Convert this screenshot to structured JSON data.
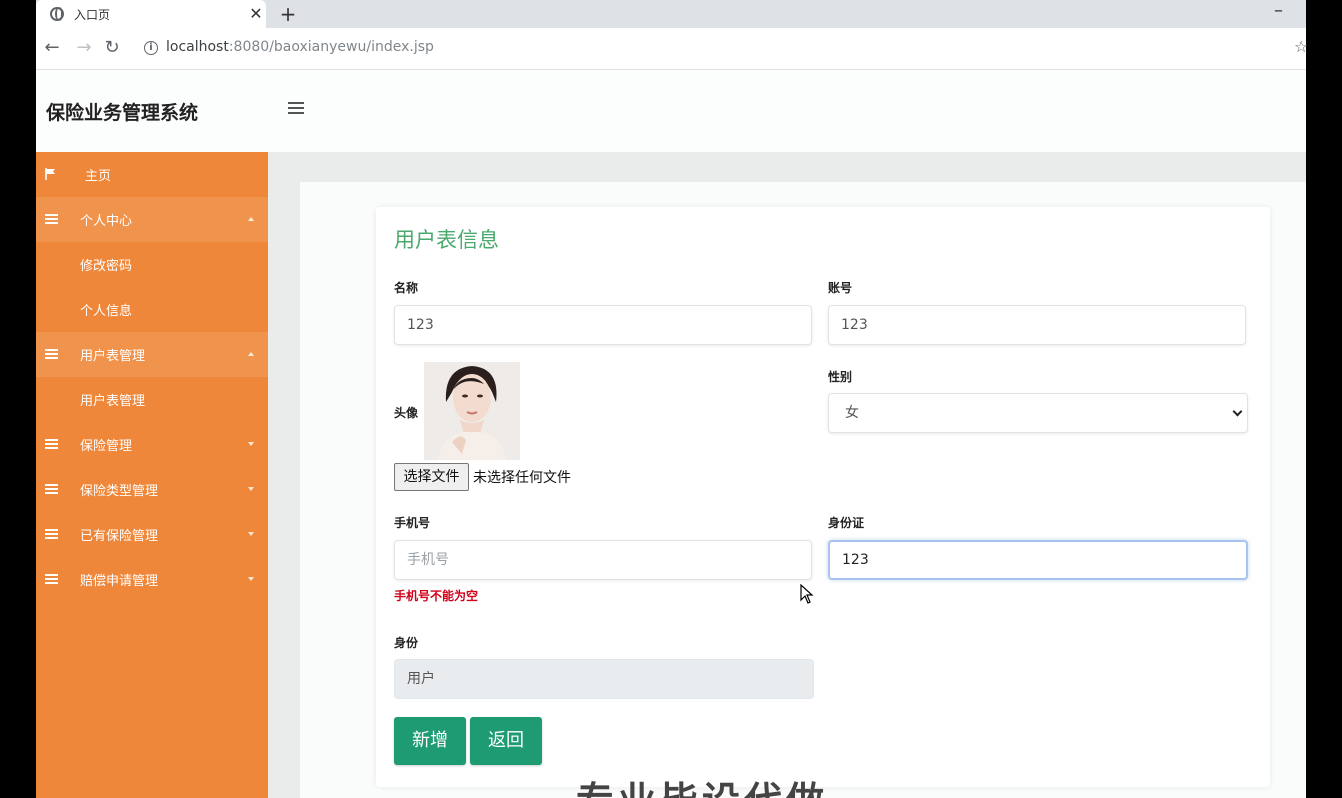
{
  "browser": {
    "tab_title": "入口页",
    "tab_close": "✕",
    "new_tab": "+",
    "minimize": "–",
    "back": "←",
    "forward": "→",
    "reload": "↻",
    "info": "i",
    "url_host": "localhost",
    "url_rest": ":8080/baoxianyewu/index.jsp",
    "bookmark": "☆"
  },
  "app": {
    "title": "保险业务管理系统"
  },
  "sidebar": {
    "items": [
      {
        "label": "主页",
        "icon": "flag-icon"
      },
      {
        "label": "个人中心",
        "icon": "grid-icon"
      },
      {
        "label": "修改密码"
      },
      {
        "label": "个人信息"
      },
      {
        "label": "用户表管理",
        "icon": "grid-icon"
      },
      {
        "label": "用户表管理"
      },
      {
        "label": "保险管理",
        "icon": "grid-icon"
      },
      {
        "label": "保险类型管理",
        "icon": "grid-icon"
      },
      {
        "label": "已有保险管理",
        "icon": "grid-icon"
      },
      {
        "label": "赔偿申请管理",
        "icon": "grid-icon"
      }
    ]
  },
  "form": {
    "title": "用户表信息",
    "name": {
      "label": "名称",
      "value": "123"
    },
    "account": {
      "label": "账号",
      "value": "123"
    },
    "avatar": {
      "label": "头像",
      "file_button": "选择文件",
      "file_status": "未选择任何文件"
    },
    "gender": {
      "label": "性别",
      "value": "女"
    },
    "phone": {
      "label": "手机号",
      "placeholder": "手机号",
      "error": "手机号不能为空"
    },
    "id_card": {
      "label": "身份证",
      "value": "123"
    },
    "role": {
      "label": "身份",
      "value": "用户"
    },
    "add_button": "新增",
    "back_button": "返回"
  },
  "watermark": "专业毕设代做",
  "colors": {
    "sidebar": "#ef873a",
    "accent_green": "#1f9b73",
    "title_green": "#4aa96c",
    "error_red": "#d0021b"
  }
}
